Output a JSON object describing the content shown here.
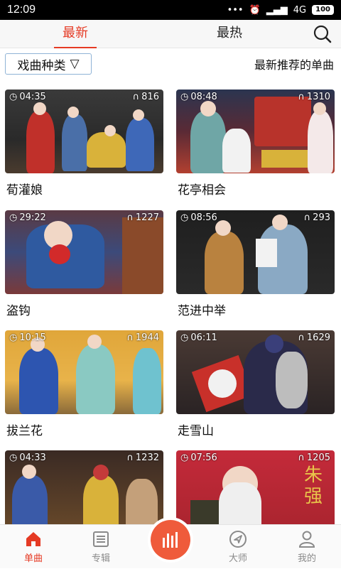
{
  "status": {
    "time": "12:09",
    "signal": "4G",
    "battery": "100"
  },
  "tabs": [
    {
      "label": "最新",
      "active": true
    },
    {
      "label": "最热",
      "active": false
    }
  ],
  "filter": {
    "label": "戏曲种类",
    "caret": "▽",
    "right_text": "最新推荐的单曲"
  },
  "songs": [
    {
      "title": "荀灌娘",
      "duration": "04:35",
      "plays": "816"
    },
    {
      "title": "花亭相会",
      "duration": "08:48",
      "plays": "1310"
    },
    {
      "title": "盗钩",
      "duration": "29:22",
      "plays": "1227"
    },
    {
      "title": "范进中举",
      "duration": "08:56",
      "plays": "293"
    },
    {
      "title": "拔兰花",
      "duration": "10:15",
      "plays": "1944"
    },
    {
      "title": "走雪山",
      "duration": "06:11",
      "plays": "1629"
    },
    {
      "title": "",
      "duration": "04:33",
      "plays": "1232"
    },
    {
      "title": "",
      "duration": "07:56",
      "plays": "1205"
    }
  ],
  "poster_text": "朱强",
  "bottom_nav": [
    {
      "label": "单曲",
      "icon": "home-icon",
      "active": true
    },
    {
      "label": "专辑",
      "icon": "album-icon",
      "active": false
    },
    {
      "label": "大师",
      "icon": "navigation-icon",
      "active": false
    },
    {
      "label": "我的",
      "icon": "user-icon",
      "active": false
    }
  ],
  "colors": {
    "accent": "#e53a24",
    "center_button": "#ef5b3b"
  }
}
